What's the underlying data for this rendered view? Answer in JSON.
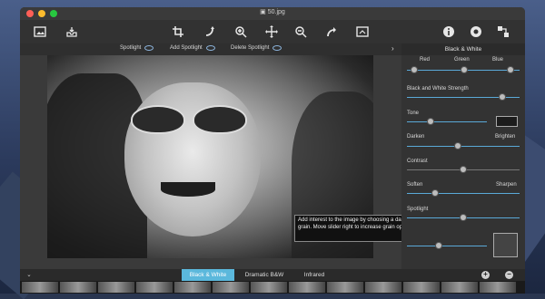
{
  "window": {
    "title": "50.jpg"
  },
  "toolbar": {
    "icons": [
      "image-icon",
      "tray-icon",
      "crop-icon",
      "rotate-icon",
      "zoom-in-icon",
      "move-icon",
      "zoom-out-icon",
      "redo-icon",
      "compare-icon",
      "info-icon",
      "settings-icon",
      "share-icon"
    ]
  },
  "subbar": {
    "spotlight": "Spotlight",
    "add_spotlight": "Add Spotlight",
    "delete_spotlight": "Delete Spotlight"
  },
  "panel": {
    "title": "Black & White",
    "red": "Red",
    "green": "Green",
    "blue": "Blue",
    "strength": "Black and White Strength",
    "tone": "Tone",
    "darken": "Darken",
    "brighten": "Brighten",
    "contrast": "Contrast",
    "soften": "Soften",
    "sharpen": "Sharpen",
    "spotlight": "Spotlight"
  },
  "sliders": {
    "red": 0.2,
    "green": 0.5,
    "blue": 0.75,
    "strength": 0.85,
    "tone": 0.3,
    "darken_brighten": 0.45,
    "contrast": 0.5,
    "soften_sharpen": 0.25,
    "spotlight": 0.5,
    "grain": 0.4
  },
  "tooltip": {
    "text": "Add interest to the image by choosing a darkroom-style grain. Move slider right to increase  grain opacity."
  },
  "bottom": {
    "tabs": [
      "Black & White",
      "Dramatic B&W",
      "Infrared"
    ],
    "active_tab": "Black & White"
  },
  "colors": {
    "accent": "#5bb8dc",
    "close": "#ff5f57",
    "minimize": "#febc2e",
    "zoom": "#28c840"
  }
}
